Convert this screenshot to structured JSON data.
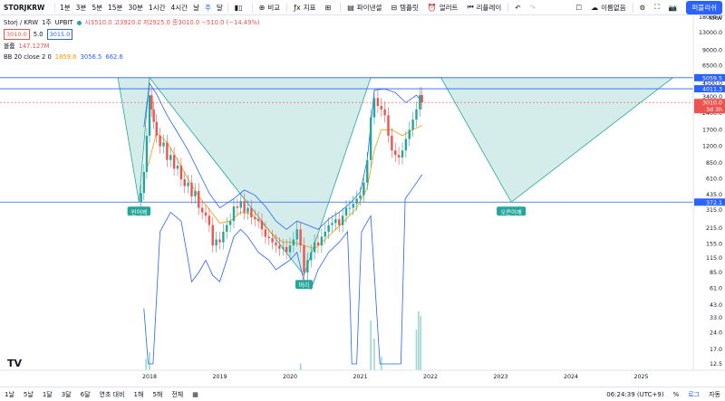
{
  "toolbar": {
    "symbol": "STORJKRW",
    "intervals": [
      "1분",
      "3분",
      "5분",
      "15분",
      "30분",
      "1시간",
      "4시간",
      "날",
      "주",
      "달"
    ],
    "active_interval": "주",
    "compare_label": "비교",
    "indicators_label": "지표",
    "financials_label": "파이낸셜",
    "templates_label": "템플릿",
    "alert_label": "얼러트",
    "replay_label": "리플레이",
    "unnamed_label": "이름없음",
    "publish_label": "퍼블리쉬"
  },
  "legend": {
    "title": "Storj / KRW",
    "interval": "1주",
    "exchange": "UPBIT",
    "ohlc": "시3510.0  고3920.0  저2925.0  종3010.0  −510.0 (−14.49%)",
    "price_a": "3010.0",
    "step": "5.0",
    "price_b": "3015.0",
    "volume_label": "볼륨",
    "volume_value": "147.127M",
    "bb_label": "BB 20 close 2 0",
    "bb_basis": "1859.6",
    "bb_upper": "3056.5",
    "bb_lower": "662.6"
  },
  "bottom": {
    "ranges": [
      "1날",
      "5날",
      "1달",
      "3달",
      "6달",
      "연초 대비",
      "1해",
      "5해",
      "전체"
    ],
    "time": "06:24:39 (UTC+9)",
    "percent": "%",
    "log": "로그",
    "auto": "자동"
  },
  "colors": {
    "up": "#26a69a",
    "down": "#ef5350",
    "bb_band": "#2962ff",
    "bb_basis": "#ff9800",
    "pattern_fill": "#26a69a",
    "level_line": "#2962ff"
  },
  "chart_data": {
    "type": "candlestick",
    "scale": "log",
    "x_ticks": [
      "2018",
      "2019",
      "2020",
      "2021",
      "2022",
      "2023",
      "2024",
      "2025"
    ],
    "y_ticks": [
      "18000.0",
      "13000.0",
      "9000.0",
      "6500.0",
      "4500.0",
      "3400.0",
      "2400.0",
      "1700.0",
      "1200.0",
      "850.0",
      "610.0",
      "435.0",
      "315.0",
      "215.0",
      "155.0",
      "115.0",
      "85.0",
      "61.0",
      "43.0",
      "33.0",
      "24.0",
      "17.0",
      "12.5"
    ],
    "y_unit_label": "KRW",
    "levels": [
      {
        "label": "5059.5",
        "value": 5059.5
      },
      {
        "label": "4011.3",
        "value": 4011.3
      },
      {
        "label": "3010.0",
        "sub": "3d 3h",
        "value": 3010.0
      },
      {
        "label": "372.1",
        "value": 372.1
      }
    ],
    "annotations": [
      {
        "label": "왼어깨",
        "date": 2017.85,
        "value": 372.1
      },
      {
        "label": "머리",
        "date": 2020.2,
        "value": 80.0
      },
      {
        "label": "오른어깨",
        "date": 2023.15,
        "value": 372.1
      }
    ],
    "pattern_polygons": [
      [
        [
          2017.55,
          5059.5
        ],
        [
          2017.85,
          372.1
        ],
        [
          2018.0,
          5059.5
        ]
      ],
      [
        [
          2018.0,
          5059.5
        ],
        [
          2020.2,
          80.0
        ],
        [
          2021.15,
          5059.5
        ]
      ],
      [
        [
          2022.15,
          5059.5
        ],
        [
          2023.15,
          372.1
        ],
        [
          2025.45,
          5059.5
        ]
      ]
    ],
    "pattern_outline": [
      [
        2017.55,
        5059.5
      ],
      [
        2017.85,
        372.1
      ],
      [
        2018.0,
        5059.5
      ],
      [
        2020.2,
        80.0
      ],
      [
        2021.15,
        5059.5
      ],
      [
        2021.85,
        5059.5
      ],
      [
        2022.15,
        5059.5
      ],
      [
        2023.15,
        372.1
      ],
      [
        2025.45,
        5059.5
      ]
    ],
    "price_series": [
      [
        2017.85,
        372
      ],
      [
        2017.88,
        450
      ],
      [
        2017.92,
        700
      ],
      [
        2017.96,
        1500
      ],
      [
        2018.0,
        3500
      ],
      [
        2018.03,
        2600
      ],
      [
        2018.06,
        2000
      ],
      [
        2018.1,
        1500
      ],
      [
        2018.15,
        1200
      ],
      [
        2018.2,
        1300
      ],
      [
        2018.25,
        900
      ],
      [
        2018.3,
        1000
      ],
      [
        2018.35,
        750
      ],
      [
        2018.4,
        800
      ],
      [
        2018.45,
        600
      ],
      [
        2018.5,
        520
      ],
      [
        2018.55,
        560
      ],
      [
        2018.6,
        420
      ],
      [
        2018.65,
        470
      ],
      [
        2018.7,
        330
      ],
      [
        2018.75,
        300
      ],
      [
        2018.8,
        280
      ],
      [
        2018.85,
        230
      ],
      [
        2018.9,
        150
      ],
      [
        2018.95,
        170
      ],
      [
        2019.0,
        160
      ],
      [
        2019.05,
        200
      ],
      [
        2019.1,
        230
      ],
      [
        2019.15,
        250
      ],
      [
        2019.2,
        340
      ],
      [
        2019.25,
        330
      ],
      [
        2019.3,
        380
      ],
      [
        2019.35,
        300
      ],
      [
        2019.4,
        330
      ],
      [
        2019.45,
        270
      ],
      [
        2019.5,
        260
      ],
      [
        2019.55,
        250
      ],
      [
        2019.6,
        210
      ],
      [
        2019.65,
        180
      ],
      [
        2019.7,
        175
      ],
      [
        2019.75,
        160
      ],
      [
        2019.8,
        150
      ],
      [
        2019.85,
        140
      ],
      [
        2019.9,
        145
      ],
      [
        2019.95,
        130
      ],
      [
        2020.0,
        150
      ],
      [
        2020.05,
        170
      ],
      [
        2020.1,
        210
      ],
      [
        2020.15,
        150
      ],
      [
        2020.2,
        85
      ],
      [
        2020.25,
        110
      ],
      [
        2020.3,
        130
      ],
      [
        2020.35,
        160
      ],
      [
        2020.4,
        150
      ],
      [
        2020.45,
        180
      ],
      [
        2020.5,
        200
      ],
      [
        2020.55,
        230
      ],
      [
        2020.6,
        240
      ],
      [
        2020.65,
        260
      ],
      [
        2020.7,
        230
      ],
      [
        2020.75,
        280
      ],
      [
        2020.8,
        330
      ],
      [
        2020.85,
        330
      ],
      [
        2020.9,
        360
      ],
      [
        2020.95,
        400
      ],
      [
        2021.0,
        430
      ],
      [
        2021.05,
        560
      ],
      [
        2021.1,
        900
      ],
      [
        2021.15,
        2200
      ],
      [
        2021.2,
        3300
      ],
      [
        2021.25,
        2800
      ],
      [
        2021.3,
        2600
      ],
      [
        2021.35,
        2300
      ],
      [
        2021.4,
        1500
      ],
      [
        2021.45,
        1100
      ],
      [
        2021.5,
        1000
      ],
      [
        2021.55,
        950
      ],
      [
        2021.6,
        1100
      ],
      [
        2021.65,
        1400
      ],
      [
        2021.7,
        1700
      ],
      [
        2021.75,
        2100
      ],
      [
        2021.8,
        2600
      ],
      [
        2021.85,
        3510
      ],
      [
        2021.88,
        3010
      ]
    ],
    "bb_upper": [
      [
        2017.92,
        1800
      ],
      [
        2018.0,
        4500
      ],
      [
        2018.1,
        3600
      ],
      [
        2018.25,
        2300
      ],
      [
        2018.4,
        1600
      ],
      [
        2018.55,
        1100
      ],
      [
        2018.7,
        700
      ],
      [
        2018.85,
        450
      ],
      [
        2019.0,
        330
      ],
      [
        2019.2,
        400
      ],
      [
        2019.35,
        480
      ],
      [
        2019.5,
        430
      ],
      [
        2019.65,
        340
      ],
      [
        2019.8,
        250
      ],
      [
        2019.95,
        210
      ],
      [
        2020.1,
        250
      ],
      [
        2020.25,
        230
      ],
      [
        2020.4,
        210
      ],
      [
        2020.55,
        260
      ],
      [
        2020.7,
        300
      ],
      [
        2020.85,
        360
      ],
      [
        2021.0,
        460
      ],
      [
        2021.1,
        900
      ],
      [
        2021.2,
        3900
      ],
      [
        2021.35,
        4000
      ],
      [
        2021.5,
        3700
      ],
      [
        2021.65,
        3000
      ],
      [
        2021.8,
        3500
      ],
      [
        2021.88,
        3056
      ]
    ],
    "bb_lower": [
      [
        2017.92,
        40
      ],
      [
        2017.98,
        12.5
      ],
      [
        2018.05,
        12.5
      ],
      [
        2018.15,
        200
      ],
      [
        2018.3,
        300
      ],
      [
        2018.45,
        250
      ],
      [
        2018.55,
        110
      ],
      [
        2018.6,
        70
      ],
      [
        2018.7,
        85
      ],
      [
        2018.8,
        110
      ],
      [
        2018.9,
        80
      ],
      [
        2019.0,
        70
      ],
      [
        2019.1,
        110
      ],
      [
        2019.2,
        180
      ],
      [
        2019.3,
        210
      ],
      [
        2019.4,
        180
      ],
      [
        2019.55,
        130
      ],
      [
        2019.7,
        110
      ],
      [
        2019.8,
        90
      ],
      [
        2019.9,
        100
      ],
      [
        2020.0,
        110
      ],
      [
        2020.1,
        130
      ],
      [
        2020.2,
        70
      ],
      [
        2020.3,
        60
      ],
      [
        2020.4,
        90
      ],
      [
        2020.55,
        130
      ],
      [
        2020.7,
        160
      ],
      [
        2020.82,
        200
      ],
      [
        2020.86,
        40
      ],
      [
        2020.88,
        12.5
      ],
      [
        2020.95,
        12.5
      ],
      [
        2021.02,
        200
      ],
      [
        2021.15,
        280
      ],
      [
        2021.28,
        12.5
      ],
      [
        2021.58,
        12.5
      ],
      [
        2021.64,
        400
      ],
      [
        2021.75,
        500
      ],
      [
        2021.88,
        663
      ]
    ],
    "bb_basis": [
      [
        2017.98,
        800
      ],
      [
        2018.1,
        1600
      ],
      [
        2018.25,
        1300
      ],
      [
        2018.4,
        900
      ],
      [
        2018.55,
        600
      ],
      [
        2018.7,
        420
      ],
      [
        2018.85,
        320
      ],
      [
        2019.0,
        240
      ],
      [
        2019.15,
        250
      ],
      [
        2019.3,
        300
      ],
      [
        2019.45,
        290
      ],
      [
        2019.6,
        240
      ],
      [
        2019.75,
        190
      ],
      [
        2019.9,
        160
      ],
      [
        2020.05,
        160
      ],
      [
        2020.2,
        150
      ],
      [
        2020.35,
        140
      ],
      [
        2020.5,
        170
      ],
      [
        2020.65,
        210
      ],
      [
        2020.8,
        260
      ],
      [
        2020.95,
        330
      ],
      [
        2021.1,
        500
      ],
      [
        2021.2,
        1100
      ],
      [
        2021.3,
        1700
      ],
      [
        2021.45,
        1700
      ],
      [
        2021.6,
        1500
      ],
      [
        2021.75,
        1700
      ],
      [
        2021.88,
        1860
      ]
    ],
    "volume_spikes": [
      [
        2017.95,
        5
      ],
      [
        2018.0,
        8
      ],
      [
        2020.15,
        3
      ],
      [
        2021.15,
        22
      ],
      [
        2021.2,
        14
      ],
      [
        2021.3,
        6
      ],
      [
        2021.8,
        18
      ],
      [
        2021.83,
        26
      ],
      [
        2021.86,
        24
      ]
    ]
  }
}
